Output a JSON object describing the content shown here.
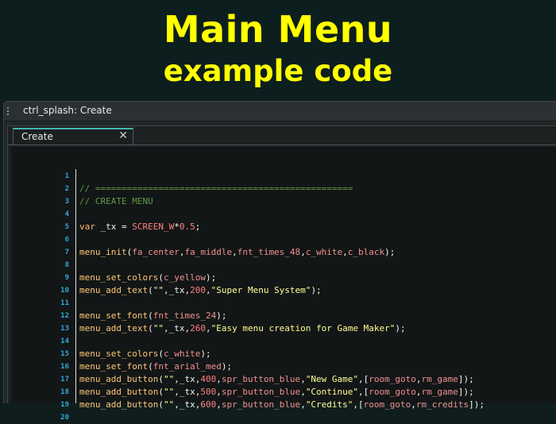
{
  "banner": {
    "title": "Main Menu",
    "subtitle": "example code",
    "title_color": "#ffff00"
  },
  "window": {
    "title": "ctrl_splash: Create",
    "drag_handle_icon": "grip-dots-icon"
  },
  "editor": {
    "tab_label": "Create",
    "close_icon": "close-icon",
    "accent_color": "#3fb8ad",
    "lines": [
      {
        "n": "1",
        "code": ""
      },
      {
        "n": "2",
        "code": "// ================================================="
      },
      {
        "n": "3",
        "code": "// CREATE MENU"
      },
      {
        "n": "4",
        "code": ""
      },
      {
        "n": "5",
        "code": "var _tx = SCREEN_W*0.5;"
      },
      {
        "n": "6",
        "code": ""
      },
      {
        "n": "7",
        "code": "menu_init(fa_center,fa_middle,fnt_times_48,c_white,c_black);"
      },
      {
        "n": "8",
        "code": ""
      },
      {
        "n": "9",
        "code": "menu_set_colors(c_yellow);"
      },
      {
        "n": "10",
        "code": "menu_add_text(\"\",_tx,200,\"Super Menu System\");"
      },
      {
        "n": "11",
        "code": ""
      },
      {
        "n": "12",
        "code": "menu_set_font(fnt_times_24);"
      },
      {
        "n": "13",
        "code": "menu_add_text(\"\",_tx,260,\"Easy menu creation for Game Maker\");"
      },
      {
        "n": "14",
        "code": ""
      },
      {
        "n": "15",
        "code": "menu_set_colors(c_white);"
      },
      {
        "n": "16",
        "code": "menu_set_font(fnt_arial_med);"
      },
      {
        "n": "17",
        "code": "menu_add_button(\"\",_tx,400,spr_button_blue,\"New Game\",[room_goto,rm_game]);"
      },
      {
        "n": "18",
        "code": "menu_add_button(\"\",_tx,500,spr_button_blue,\"Continue\",[room_goto,rm_game]);"
      },
      {
        "n": "19",
        "code": "menu_add_button(\"\",_tx,600,spr_button_blue,\"Credits\",[room_goto,rm_credits]);"
      },
      {
        "n": "20",
        "code": ""
      }
    ]
  }
}
